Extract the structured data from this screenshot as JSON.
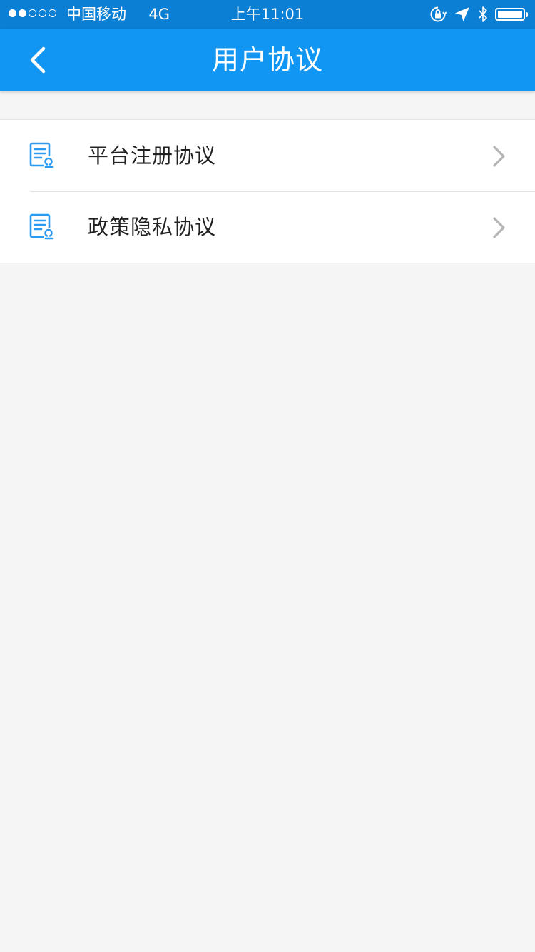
{
  "status_bar": {
    "carrier": "中国移动",
    "network": "4G",
    "time": "上午11:01",
    "signal_strength": 2,
    "signal_max": 5,
    "icons": [
      "orientation-lock-icon",
      "location-icon",
      "bluetooth-icon",
      "battery-icon"
    ],
    "battery_level": 1.0
  },
  "nav": {
    "title": "用户协议",
    "back_icon": "chevron-left-icon"
  },
  "agreements": [
    {
      "label": "平台注册协议",
      "icon": "document-seal-icon",
      "arrow_icon": "chevron-right-icon"
    },
    {
      "label": "政策隐私协议",
      "icon": "document-seal-icon",
      "arrow_icon": "chevron-right-icon"
    }
  ],
  "colors": {
    "status_bar": "#0a7fd4",
    "nav_bar": "#1296f3",
    "icon_accent": "#2a9bf0",
    "background": "#f5f5f5",
    "chevron": "#b5b5b5"
  }
}
